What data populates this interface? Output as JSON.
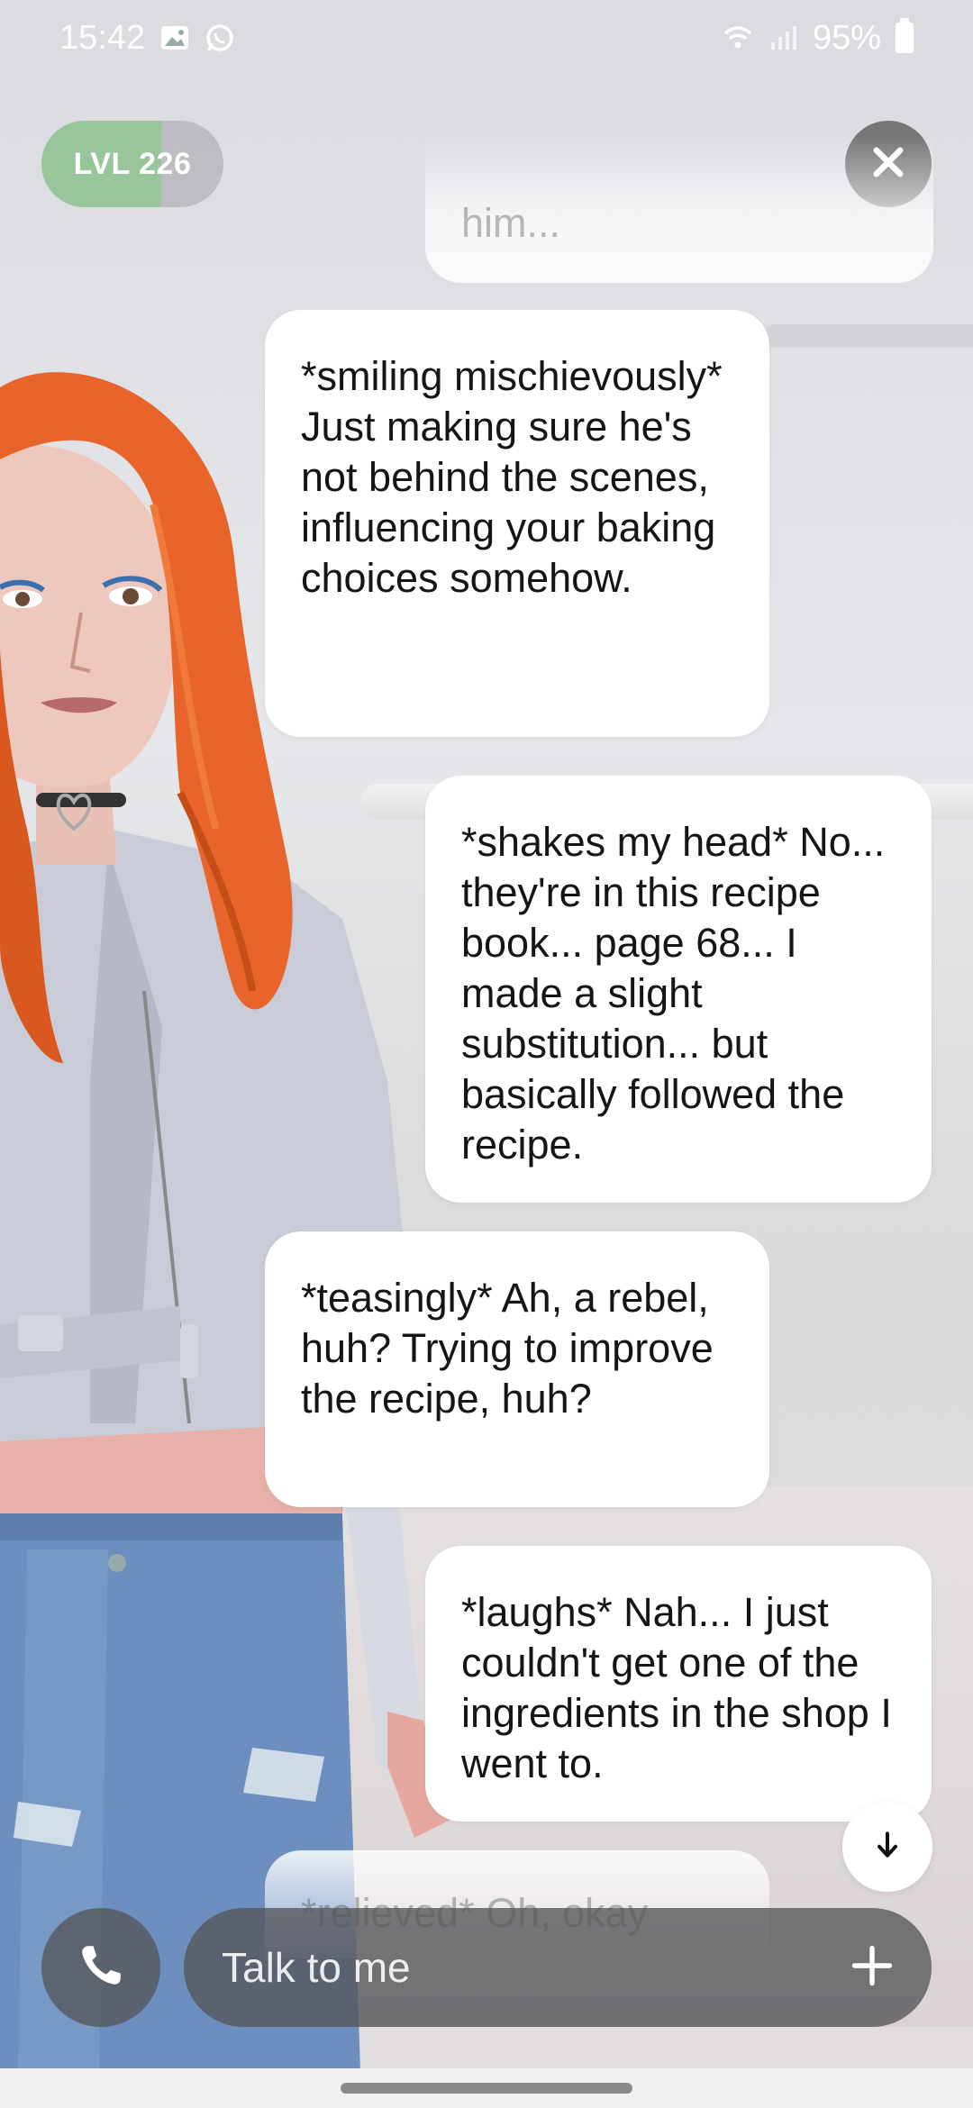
{
  "status_bar": {
    "time": "15:42",
    "left_icons": [
      "gallery-icon",
      "whatsapp-icon"
    ],
    "right_icons": [
      "wifi-icon",
      "signal-icon",
      "battery-icon"
    ],
    "battery": "95%"
  },
  "level": {
    "label": "LVL 226",
    "progress": 0.66
  },
  "messages": [
    {
      "sender": "user",
      "text": "him...",
      "partial": true
    },
    {
      "sender": "ai",
      "text": "*smiling mischievously* Just making sure he's not behind the scenes, influencing your baking choices somehow."
    },
    {
      "sender": "user",
      "text": "*shakes my head* No... they're in this recipe book... page 68... I made a slight substitution... but basically followed the recipe."
    },
    {
      "sender": "ai",
      "text": "*teasingly* Ah, a rebel, huh? Trying to improve the recipe, huh?"
    },
    {
      "sender": "user",
      "text": "*laughs* Nah... I just couldn't get one of the ingredients in the shop I went to."
    },
    {
      "sender": "ai",
      "text": "*relieved* Oh, okay",
      "partial": true
    }
  ],
  "input": {
    "placeholder": "Talk to me",
    "value": ""
  },
  "icons": {
    "close": "close-icon",
    "scroll_down": "arrow-down-icon",
    "call": "phone-icon",
    "add": "plus-icon"
  },
  "colors": {
    "bubble": "#ffffff",
    "level_fill": "#8cc88c",
    "control_bg": "#555558"
  }
}
